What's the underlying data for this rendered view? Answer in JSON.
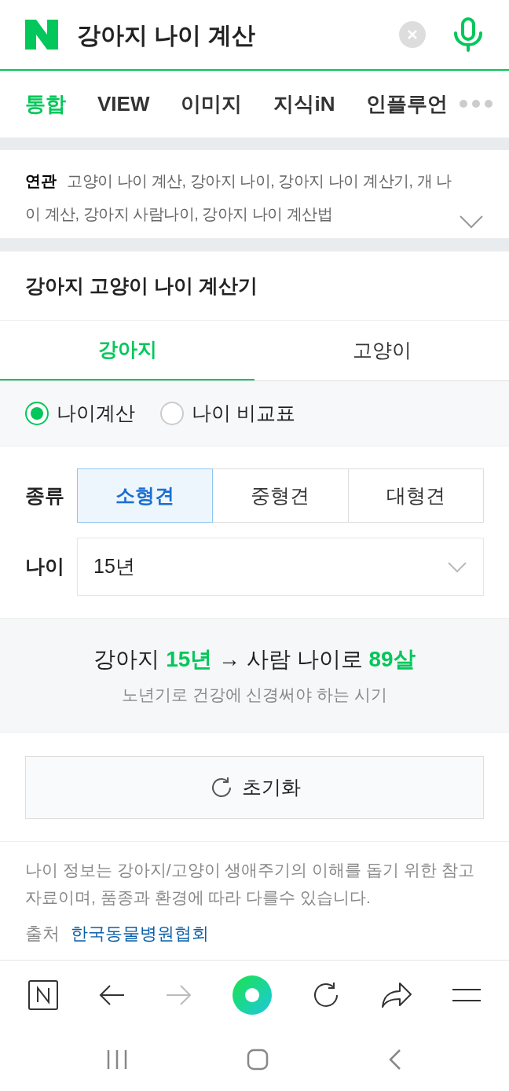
{
  "search": {
    "query": "강아지 나이 계산"
  },
  "tabs": [
    {
      "label": "통합",
      "selected": true
    },
    {
      "label": "VIEW",
      "selected": false
    },
    {
      "label": "이미지",
      "selected": false
    },
    {
      "label": "지식iN",
      "selected": false
    },
    {
      "label": "인플루언",
      "selected": false
    }
  ],
  "related": {
    "label": "연관",
    "text": "고양이 나이 계산, 강아지 나이, 강아지 나이 계산기, 개 나이 계산, 강아지 사람나이, 강아지 나이 계산법"
  },
  "calculator": {
    "title": "강아지 고양이 나이 계산기",
    "animal_tabs": [
      {
        "label": "강아지",
        "selected": true
      },
      {
        "label": "고양이",
        "selected": false
      }
    ],
    "modes": [
      {
        "label": "나이계산",
        "selected": true
      },
      {
        "label": "나이 비교표",
        "selected": false
      }
    ],
    "breed": {
      "label": "종류",
      "options": [
        {
          "label": "소형견",
          "selected": true
        },
        {
          "label": "중형견",
          "selected": false
        },
        {
          "label": "대형견",
          "selected": false
        }
      ]
    },
    "age": {
      "label": "나이",
      "value": "15년"
    },
    "result": {
      "text": "강아지 **15년** → 사람 나이로 **89살**",
      "note": "노년기로 건강에 신경써야 하는 시기"
    },
    "reset_button": "초기화",
    "disclaimer": "나이 정보는 강아지/고양이 생애주기의 이해를 돕기 위한 참고 자료이며, 품종과 환경에 따라 다를수 있습니다.",
    "source": {
      "label": "출처",
      "link": "한국동물병원협회"
    }
  }
}
